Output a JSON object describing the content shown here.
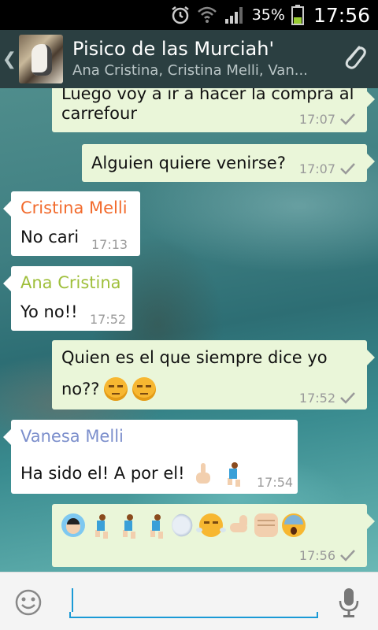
{
  "status_bar": {
    "battery_percent": "35%",
    "time": "17:56"
  },
  "header": {
    "title": "Pisico de las Murciah'",
    "subtitle": "Ana Cristina, Cristina Melli, Van..."
  },
  "colors": {
    "outgoing_bubble": "#eaf6d9",
    "incoming_bubble": "#ffffff",
    "sender_cristina": "#f26b2d",
    "sender_ana": "#9fbf3b",
    "sender_vanesa": "#7c8fcc",
    "accent": "#1a9ad6"
  },
  "messages": [
    {
      "direction": "out",
      "text_line1": "Luego voy a ir a hacer la compra al",
      "text_line2": "carrefour",
      "time": "17:07",
      "status": "check-icon"
    },
    {
      "direction": "out",
      "text": "Alguien quiere venirse?",
      "time": "17:07",
      "status": "check-icon"
    },
    {
      "direction": "in",
      "sender": "Cristina Melli",
      "text": "No cari",
      "time": "17:13"
    },
    {
      "direction": "in",
      "sender": "Ana Cristina",
      "text": "Yo no!!",
      "time": "17:52"
    },
    {
      "direction": "out",
      "text_line1": "Quien es el que siempre dice yo",
      "text_line2": "no??",
      "emojis": [
        "unamused-face-icon",
        "unamused-face-icon"
      ],
      "time": "17:52",
      "status": "check-icon"
    },
    {
      "direction": "in",
      "sender": "Vanesa Melli",
      "text": "Ha sido el! A por el!",
      "emojis": [
        "pointing-up-icon",
        "runner-icon"
      ],
      "time": "17:54"
    },
    {
      "direction": "out",
      "emojis": [
        "cold-sweat-icon",
        "runner-icon",
        "runner-icon",
        "runner-icon",
        "dash-icon",
        "triumph-face-icon",
        "muscle-icon",
        "fist-icon",
        "scream-face-icon"
      ],
      "time": "17:56",
      "status": "check-icon"
    }
  ],
  "input": {
    "value": "",
    "placeholder": ""
  },
  "icons": {
    "alarm": "alarm-icon",
    "wifi": "wifi-icon",
    "signal": "signal-icon",
    "battery": "battery-icon",
    "back": "back-chevron-icon",
    "attach": "paperclip-icon",
    "emoji": "smiley-icon",
    "mic": "microphone-icon"
  }
}
